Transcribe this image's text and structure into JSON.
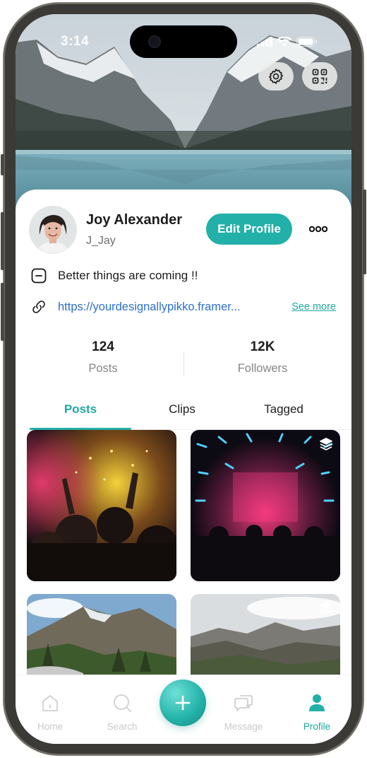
{
  "status_bar": {
    "time": "3:14"
  },
  "profile": {
    "name": "Joy Alexander",
    "handle": "J_Jay",
    "edit_label": "Edit Profile",
    "bio": "Better things are coming !!",
    "link": "https://yourdesignallypikko.framer...",
    "see_more": "See more"
  },
  "stats": [
    {
      "value": "124",
      "label": "Posts"
    },
    {
      "value": "12K",
      "label": "Followers"
    }
  ],
  "tabs": [
    {
      "label": "Posts",
      "active": true
    },
    {
      "label": "Clips",
      "active": false
    },
    {
      "label": "Tagged",
      "active": false
    }
  ],
  "posts": [
    {
      "icon": "concert-crowd-photo",
      "multi": false
    },
    {
      "icon": "nightclub-lights-photo",
      "multi": true
    },
    {
      "icon": "mountain-forest-photo",
      "multi": false
    },
    {
      "icon": "mountain-range-photo",
      "multi": true
    }
  ],
  "nav": [
    {
      "label": "Home",
      "icon": "home-icon",
      "active": false
    },
    {
      "label": "Search",
      "icon": "search-icon",
      "active": false
    },
    {
      "label": "Message",
      "icon": "message-icon",
      "active": false
    },
    {
      "label": "Profile",
      "icon": "person-icon",
      "active": true
    }
  ],
  "colors": {
    "accent": "#22b0a8",
    "link": "#2d6fcf",
    "inactive": "#c9c9c9"
  }
}
